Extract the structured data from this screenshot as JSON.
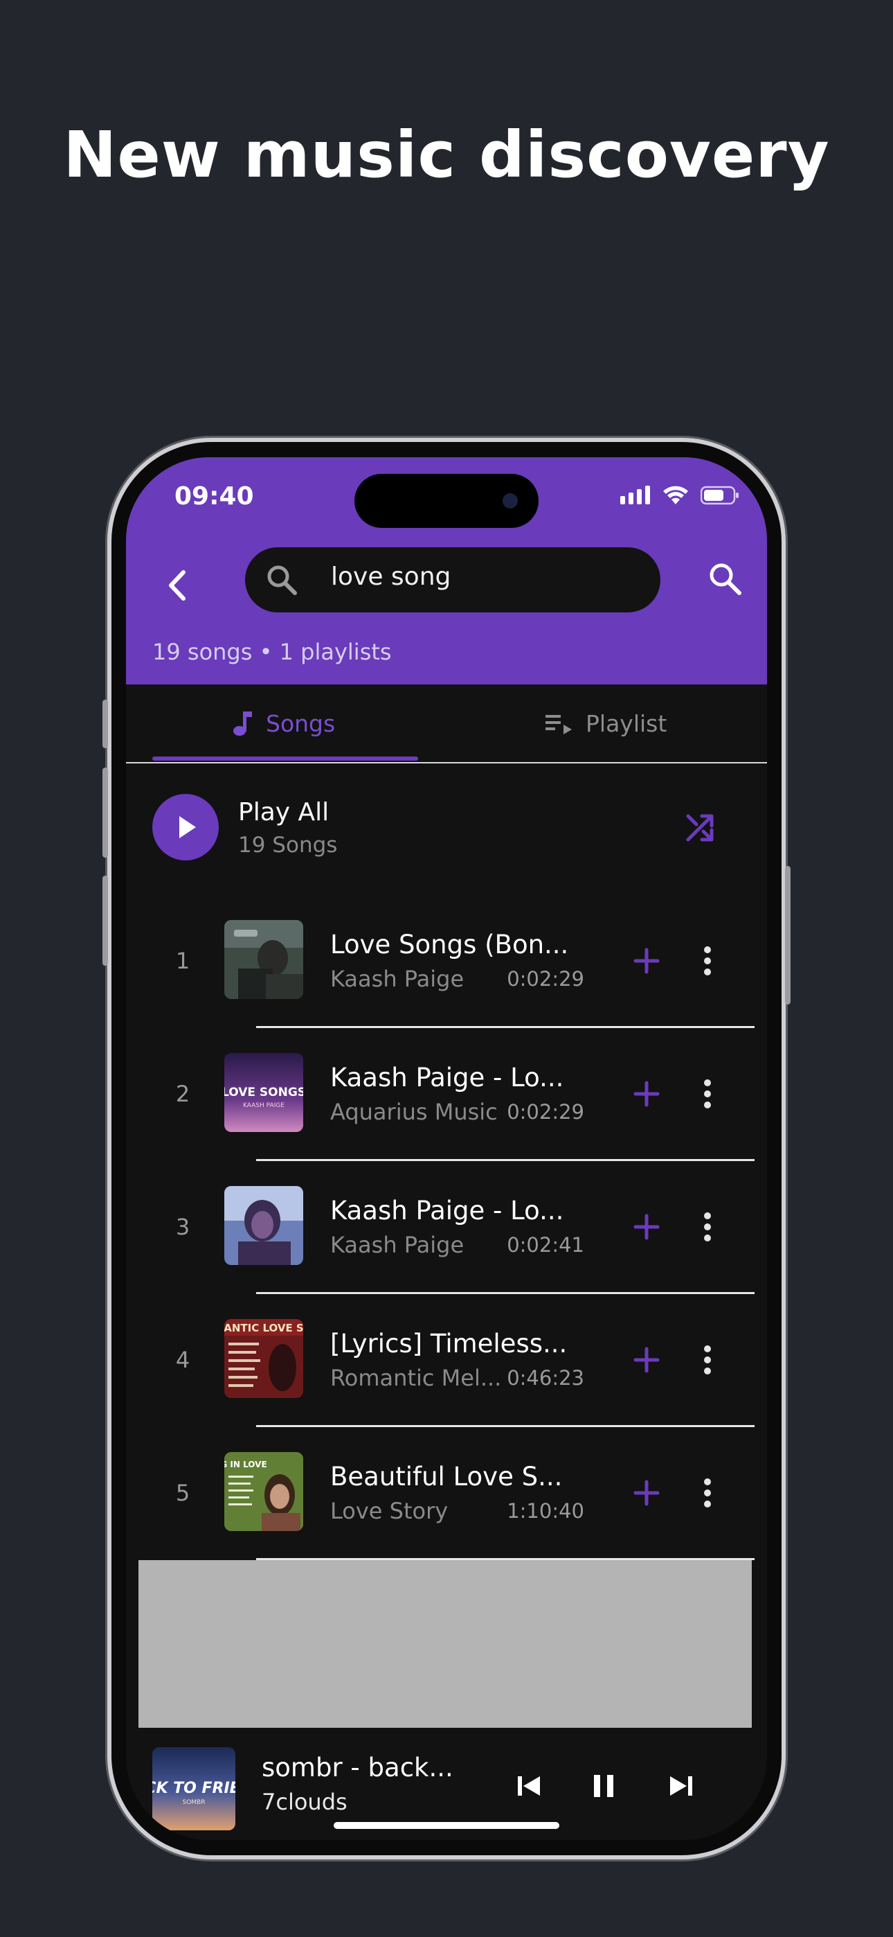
{
  "headline": "New music discovery",
  "status": {
    "time": "09:40"
  },
  "search": {
    "query": "love song"
  },
  "result_count": "19 songs • 1 playlists",
  "tabs": [
    {
      "label": "Songs",
      "active": true
    },
    {
      "label": "Playlist",
      "active": false
    }
  ],
  "play_all": {
    "title": "Play All",
    "subtitle": "19 Songs"
  },
  "songs": [
    {
      "num": "1",
      "title": "Love Songs (Bon...",
      "artist": "Kaash Paige",
      "duration": "0:02:29"
    },
    {
      "num": "2",
      "title": "Kaash Paige - Lo...",
      "artist": "Aquarius Music",
      "duration": "0:02:29"
    },
    {
      "num": "3",
      "title": "Kaash Paige - Lo...",
      "artist": "Kaash Paige",
      "duration": "0:02:41"
    },
    {
      "num": "4",
      "title": "[Lyrics] Timeless...",
      "artist": "Romantic Mel...",
      "duration": "0:46:23"
    },
    {
      "num": "5",
      "title": "Beautiful Love S...",
      "artist": "Love Story",
      "duration": "1:10:40"
    }
  ],
  "thumb_text": {
    "love_songs": "LOVE SONGS",
    "kaash_paige": "KAASH PAIGE",
    "romantic": "ANTIC LOVE S",
    "in_love": "G IN LOVE",
    "player_art": "CK TO FRIE",
    "player_art_sub": "SOMBR"
  },
  "now_playing": {
    "title": "sombr - back...",
    "artist": "7clouds",
    "state": "playing"
  },
  "icons": {
    "back": "back-arrow-icon",
    "search": "search-icon",
    "music_note": "music-note-icon",
    "playlist": "playlist-icon",
    "play": "play-icon",
    "shuffle": "shuffle-icon",
    "add": "plus-icon",
    "more": "more-vertical-icon",
    "previous": "skip-previous-icon",
    "pause": "pause-icon",
    "next": "skip-next-icon"
  },
  "colors": {
    "accent": "#6a3bbb",
    "background": "#23262d",
    "screen": "#121212"
  }
}
